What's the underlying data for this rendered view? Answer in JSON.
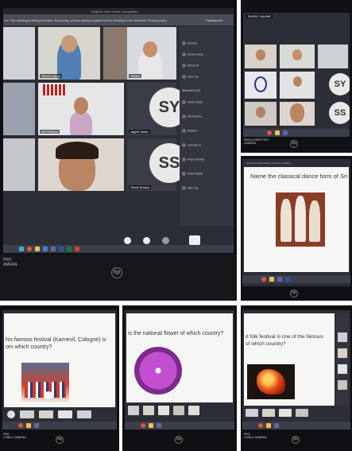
{
  "photo_main": {
    "window_title": "Subjects Inter House Competition",
    "notice": "ed. The meeting is being recorded. By joining, you are giving consent for the meeting to be recorded. Privacy policy",
    "side_panel_title": "Participants",
    "tiles": [
      {
        "name": "Shrree Nahar"
      },
      {
        "name": "Tithika"
      },
      {
        "name": "Adi Sharma"
      },
      {
        "name": "Jagriti Yadav"
      },
      {
        "name": "Shruti Shukla"
      }
    ],
    "avatar_sy": "SY",
    "avatar_ss": "SS",
    "participants": [
      "Sharma",
      "Suzein Garg",
      "Shruti Sh",
      "Vera Lily",
      "Attendees (32)",
      "Aarav Aryan",
      "Adi Sharma",
      "Dhyanvi",
      "Gaurave B",
      "Kiara Dhariya",
      "Mahit Gahla",
      "Nitin Vey"
    ],
    "camera_label": "PRO\nAMERA"
  },
  "photo_topright": {
    "avatar_sy": "SY",
    "avatar_ss": "SS",
    "cam_label": "INTELLIGENT PRO\nCAMERA",
    "mini_tile_name": "SHREE NAHAR"
  },
  "photo_midright": {
    "notice": "... Recording this meeting is being recorded...",
    "slide_question": "Name the classical dance form of Sri Lanka"
  },
  "photo_bl": {
    "slide_question": "his famous festival (Karnevil, Cologne) is\nom which country?",
    "cam_label": "PRO\n4 DIM & CAMERA"
  },
  "photo_bm": {
    "slide_question": "is the national flower of which country?"
  },
  "photo_br": {
    "slide_question": "d folk festival is one of the famous\nof which country?",
    "cam_label": "PRO\n4 DIM & CAMERA"
  },
  "colors": {
    "screen_bg": "#2b2e36",
    "slide_bg": "#f6f6f4",
    "taskbar": "#3b3f4a",
    "dahlia": "#c24fd0"
  }
}
